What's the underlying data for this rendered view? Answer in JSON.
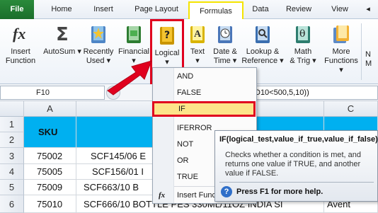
{
  "tabs": [
    "File",
    "Home",
    "Insert",
    "Page Layout",
    "Formulas",
    "Data",
    "Review",
    "View",
    "◂"
  ],
  "ribbon": {
    "insert_function": [
      "Insert",
      "Function"
    ],
    "autosum": [
      "AutoSum ▾",
      ""
    ],
    "recently_used": [
      "Recently",
      "Used ▾"
    ],
    "financial": [
      "Financial",
      "▾"
    ],
    "logical": [
      "Logical",
      "▾"
    ],
    "text": [
      "Text",
      "▾"
    ],
    "date_time": [
      "Date &",
      "Time ▾"
    ],
    "lookup": [
      "Lookup &",
      "Reference ▾"
    ],
    "math_trig": [
      "Math",
      "& Trig ▾"
    ],
    "more_functions": [
      "More",
      "Functions ▾"
    ],
    "name_manager": [
      "N",
      "M"
    ]
  },
  "formula_bar": {
    "name_box": "F10",
    "formula": "D10<500,5,10))"
  },
  "grid": {
    "columns": [
      "A",
      "C"
    ],
    "rows": [
      "1",
      "2",
      "3",
      "4",
      "5",
      "6"
    ],
    "header_cell": "SKU",
    "data": [
      {
        "sku": "75002",
        "desc": "SCF145/06 E"
      },
      {
        "sku": "75005",
        "desc": "SCF156/01 I"
      },
      {
        "sku": "75009",
        "desc": "SCF663/10 B"
      },
      {
        "sku": "75010",
        "desc": "SCF666/10 BOTTLE PES 330ML/11OZ INDIA SI",
        "c": "Avent"
      }
    ]
  },
  "logical_menu": {
    "items": [
      "AND",
      "FALSE",
      "IF",
      "IFERROR",
      "NOT",
      "OR",
      "TRUE"
    ],
    "insert_function": "Insert Func"
  },
  "tooltip": {
    "signature": "IF(logical_test,value_if_true,value_if_false)",
    "description": "Checks whether a condition is met, and returns one value if TRUE, and another value if FALSE.",
    "help": "Press F1 for more help."
  },
  "colors": {
    "file_tab": "#1b6e2b",
    "formulas_highlight": "#f5e400",
    "callout_red": "#e0001e",
    "header_cell": "#00b0f0",
    "if_highlight": "#fde48a"
  }
}
